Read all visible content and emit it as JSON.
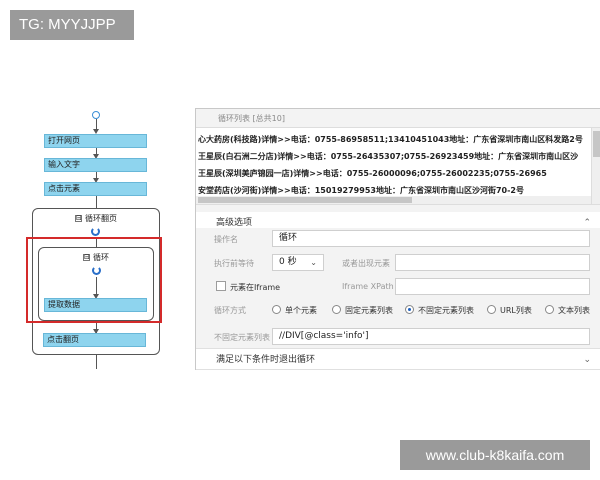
{
  "watermarks": {
    "top_left": "TG: MYYJJPP",
    "bottom_right": "www.club-k8kaifa.com"
  },
  "flow": {
    "steps": {
      "open_page": "打开网页",
      "input_text": "输入文字",
      "click_element": "点击元素",
      "extract_data": "提取数据",
      "click_next": "点击翻页"
    },
    "outer_loop_label": "循环翻页",
    "inner_loop_label": "循环",
    "collapse_symbol": "⊟"
  },
  "panel": {
    "list_title": "循环列表 [总共10]",
    "list_rows": [
      "心大药房(科技路)详情>>电话：0755-86958511;13410451043地址：广东省深圳市南山区科发路2号",
      "王星辰(白石洲二分店)详情>>电话：0755-26435307;0755-26923459地址：广东省深圳市南山区沙",
      "王星辰(深圳美庐锦园一店)详情>>电话：0755-26000096;0755-26002235;0755-26965",
      "安堂药店(沙河街)详情>>电话：15019279953地址：广东省深圳市南山区沙河街70-2号"
    ],
    "advanced_title": "高级选项",
    "labels": {
      "op_name": "操作名",
      "wait_before": "执行前等待",
      "or_appear": "或者出现元素",
      "element_in_iframe": "元素在Iframe",
      "iframe_xpath": "Iframe XPath",
      "loop_mode": "循环方式",
      "unfixed_list": "不固定元素列表"
    },
    "values": {
      "op_name": "循环",
      "wait_before": "0 秒",
      "unfixed_list": "//DIV[@class='info']"
    },
    "loop_modes": [
      "单个元素",
      "固定元素列表",
      "不固定元素列表",
      "URL列表",
      "文本列表"
    ],
    "loop_mode_selected": "不固定元素列表",
    "exit_condition_title": "满足以下条件时退出循环"
  }
}
